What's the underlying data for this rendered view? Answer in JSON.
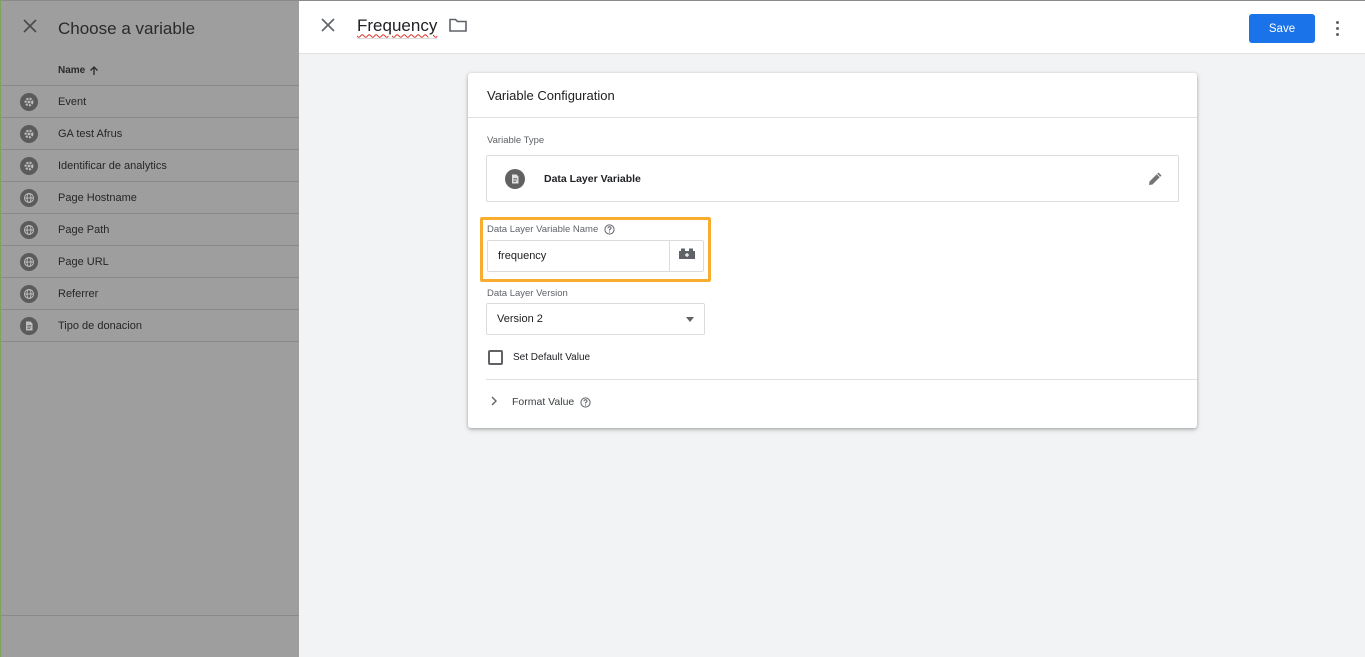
{
  "chooser": {
    "title": "Choose a variable",
    "column_name": "Name",
    "items": [
      {
        "label": "Event",
        "icon": "gear-icon"
      },
      {
        "label": "GA test Afrus",
        "icon": "gear-icon"
      },
      {
        "label": "Identificar de analytics",
        "icon": "gear-icon"
      },
      {
        "label": "Page Hostname",
        "icon": "globe-icon"
      },
      {
        "label": "Page Path",
        "icon": "globe-icon"
      },
      {
        "label": "Page URL",
        "icon": "globe-icon"
      },
      {
        "label": "Referrer",
        "icon": "globe-icon"
      },
      {
        "label": "Tipo de donacion",
        "icon": "document-icon"
      }
    ]
  },
  "editor": {
    "variable_name": "Frequency",
    "save_label": "Save"
  },
  "card": {
    "title": "Variable Configuration",
    "type_label": "Variable Type",
    "type_value": "Data Layer Variable",
    "dlv_name_label": "Data Layer Variable Name",
    "dlv_name_value": "frequency",
    "version_label": "Data Layer Version",
    "version_value": "Version 2",
    "default_value_label": "Set Default Value",
    "format_value_label": "Format Value"
  },
  "colors": {
    "accent": "#1a73e8",
    "highlight": "#f9ad2f",
    "overlay": "#9e9e9e"
  }
}
